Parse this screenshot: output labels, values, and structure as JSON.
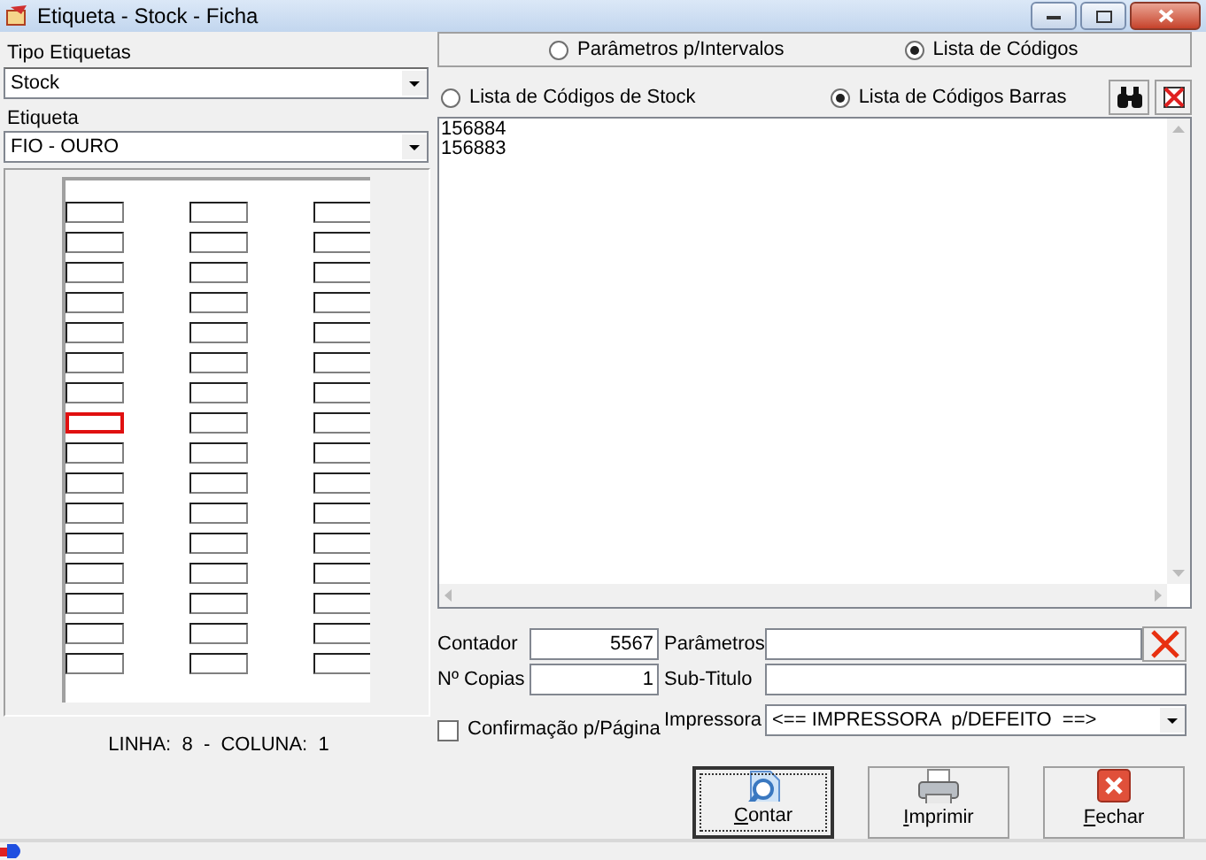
{
  "window": {
    "title": "Etiqueta - Stock - Ficha"
  },
  "tipo_etiquetas": {
    "label": "Tipo Etiquetas",
    "value": "Stock"
  },
  "etiqueta": {
    "label": "Etiqueta",
    "value": "FIO - OURO"
  },
  "label_sheet": {
    "rows": [
      {
        "cells": [
          {
            "selected": false
          },
          {
            "selected": false
          },
          {
            "selected": false
          }
        ]
      },
      {
        "cells": [
          {
            "selected": false
          },
          {
            "selected": false
          },
          {
            "selected": false
          }
        ]
      },
      {
        "cells": [
          {
            "selected": false
          },
          {
            "selected": false
          },
          {
            "selected": false
          }
        ]
      },
      {
        "cells": [
          {
            "selected": false
          },
          {
            "selected": false
          },
          {
            "selected": false
          }
        ]
      },
      {
        "cells": [
          {
            "selected": false
          },
          {
            "selected": false
          },
          {
            "selected": false
          }
        ]
      },
      {
        "cells": [
          {
            "selected": false
          },
          {
            "selected": false
          },
          {
            "selected": false
          }
        ]
      },
      {
        "cells": [
          {
            "selected": false
          },
          {
            "selected": false
          },
          {
            "selected": false
          }
        ]
      },
      {
        "cells": [
          {
            "selected": true
          },
          {
            "selected": false
          },
          {
            "selected": false
          }
        ]
      },
      {
        "cells": [
          {
            "selected": false
          },
          {
            "selected": false
          },
          {
            "selected": false
          }
        ]
      },
      {
        "cells": [
          {
            "selected": false
          },
          {
            "selected": false
          },
          {
            "selected": false
          }
        ]
      },
      {
        "cells": [
          {
            "selected": false
          },
          {
            "selected": false
          },
          {
            "selected": false
          }
        ]
      },
      {
        "cells": [
          {
            "selected": false
          },
          {
            "selected": false
          },
          {
            "selected": false
          }
        ]
      },
      {
        "cells": [
          {
            "selected": false
          },
          {
            "selected": false
          },
          {
            "selected": false
          }
        ]
      },
      {
        "cells": [
          {
            "selected": false
          },
          {
            "selected": false
          },
          {
            "selected": false
          }
        ]
      },
      {
        "cells": [
          {
            "selected": false
          },
          {
            "selected": false
          },
          {
            "selected": false
          }
        ]
      },
      {
        "cells": [
          {
            "selected": false
          },
          {
            "selected": false
          },
          {
            "selected": false
          }
        ]
      }
    ]
  },
  "position": "LINHA:  8  -  COLUNA:  1",
  "mode_options": [
    {
      "label": "Parâmetros p/Intervalos",
      "selected": false
    },
    {
      "label": "Lista de Códigos",
      "selected": true
    }
  ],
  "list_options": [
    {
      "label": "Lista de Códigos de Stock",
      "selected": false
    },
    {
      "label": "Lista de Códigos Barras",
      "selected": true
    }
  ],
  "codes": [
    "156884",
    "156883"
  ],
  "contador": {
    "label": "Contador",
    "value": "5567"
  },
  "copias": {
    "label": "Nº Copias",
    "value": "1"
  },
  "parametros": {
    "label": "Parâmetros"
  },
  "sub_titulo": {
    "label": "Sub-Titulo"
  },
  "confirmacao": {
    "label": "Confirmação p/Página",
    "checked": false
  },
  "impressora": {
    "label": "Impressora",
    "value": "<== IMPRESSORA  p/DEFEITO  ==>"
  },
  "buttons": [
    {
      "label": "Contar",
      "kind": "count",
      "focused": true
    },
    {
      "label": "Imprimir",
      "kind": "print",
      "focused": false
    },
    {
      "label": "Fechar",
      "kind": "close",
      "focused": false
    }
  ]
}
